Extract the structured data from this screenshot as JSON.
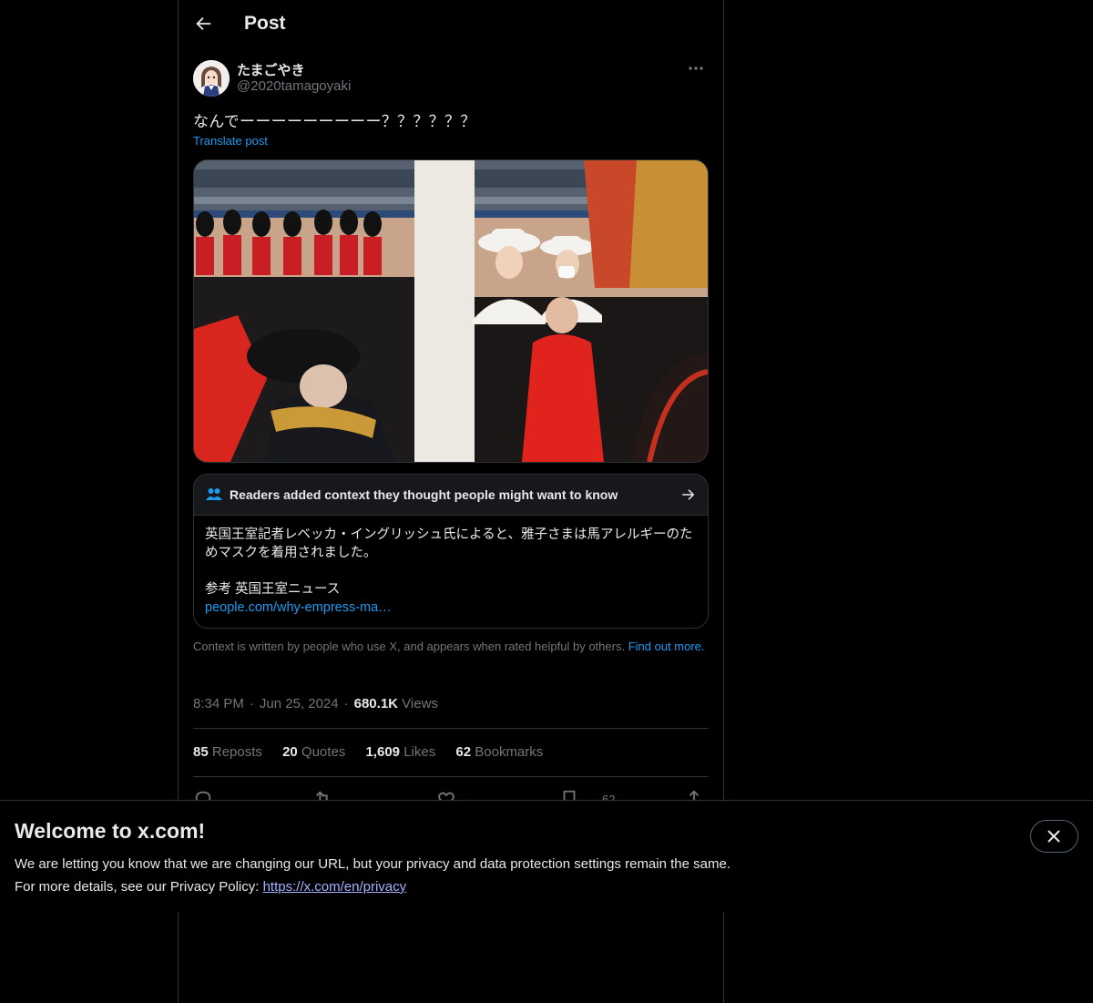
{
  "header": {
    "title": "Post"
  },
  "author": {
    "display_name": "たまごやき",
    "handle": "@2020tamagoyaki"
  },
  "post": {
    "text": "なんでーーーーーーーーー？？？？？？",
    "translate_label": "Translate post"
  },
  "community_note": {
    "title": "Readers added context they thought people might want to know",
    "body": "英国王室記者レベッカ・イングリッシュ氏によると、雅子さまは馬アレルギーのためマスクを着用されました。",
    "reference_label": "参考 英国王室ニュース",
    "link_text": "people.com/why-empress-ma…"
  },
  "context_info": {
    "text": "Context is written by people who use X, and appears when rated helpful by others.",
    "link": "Find out more."
  },
  "meta": {
    "time": "8:34 PM",
    "date": "Jun 25, 2024",
    "views_count": "680.1K",
    "views_label": "Views"
  },
  "stats": [
    {
      "count": "85",
      "label": "Reposts"
    },
    {
      "count": "20",
      "label": "Quotes"
    },
    {
      "count": "1,609",
      "label": "Likes"
    },
    {
      "count": "62",
      "label": "Bookmarks"
    }
  ],
  "actions": {
    "bookmark_count": "62"
  },
  "banner": {
    "title": "Welcome to x.com!",
    "line1": "We are letting you know that we are changing our URL, but your privacy and data protection settings remain the same.",
    "line2_prefix": "For more details, see our Privacy Policy: ",
    "privacy_link": "https://x.com/en/privacy"
  },
  "colors": {
    "accent": "#1d9bf0",
    "background": "#000000",
    "secondary_text": "#71767b",
    "border": "#2f3336",
    "banner_link": "#a3b2ff"
  }
}
